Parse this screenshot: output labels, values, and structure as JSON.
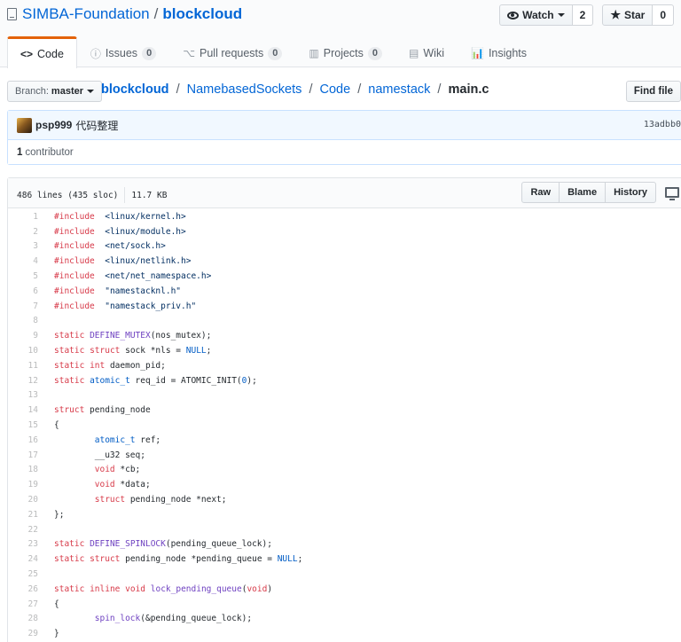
{
  "repo": {
    "owner": "SIMBA-Foundation",
    "separator": "/",
    "name": "blockcloud",
    "icon": "repo-book-icon"
  },
  "actions": {
    "watch_label": "Watch",
    "watch_count": "2",
    "star_label": "Star",
    "star_count": "0"
  },
  "tabs": [
    {
      "label": "Code",
      "icon": "code-icon",
      "selected": true
    },
    {
      "label": "Issues",
      "icon": "issue-icon",
      "count": "0"
    },
    {
      "label": "Pull requests",
      "icon": "pull-request-icon",
      "count": "0"
    },
    {
      "label": "Projects",
      "icon": "project-icon",
      "count": "0"
    },
    {
      "label": "Wiki",
      "icon": "book-icon"
    },
    {
      "label": "Insights",
      "icon": "graph-icon"
    }
  ],
  "branch": {
    "prefix": "Branch:",
    "name": "master"
  },
  "breadcrumb": {
    "root": "blockcloud",
    "parts": [
      "NamebasedSockets",
      "Code",
      "namestack"
    ],
    "file": "main.c",
    "sep": "/"
  },
  "find_file_label": "Find file",
  "commit": {
    "author": "psp999",
    "message": "代码整理",
    "sha": "13adbb0"
  },
  "contributors": {
    "count": "1",
    "label": "contributor"
  },
  "file": {
    "lines_info": "486 lines (435 sloc)",
    "size": "11.7 KB",
    "raw_label": "Raw",
    "blame_label": "Blame",
    "history_label": "History",
    "desktop_icon": "desktop-icon"
  },
  "code_lines": [
    {
      "n": "1",
      "tokens": [
        [
          "k",
          "#include"
        ],
        [
          "",
          "  "
        ],
        [
          "s",
          "<linux/kernel.h>"
        ]
      ]
    },
    {
      "n": "2",
      "tokens": [
        [
          "k",
          "#include"
        ],
        [
          "",
          "  "
        ],
        [
          "s",
          "<linux/module.h>"
        ]
      ]
    },
    {
      "n": "3",
      "tokens": [
        [
          "k",
          "#include"
        ],
        [
          "",
          "  "
        ],
        [
          "s",
          "<net/sock.h>"
        ]
      ]
    },
    {
      "n": "4",
      "tokens": [
        [
          "k",
          "#include"
        ],
        [
          "",
          "  "
        ],
        [
          "s",
          "<linux/netlink.h>"
        ]
      ]
    },
    {
      "n": "5",
      "tokens": [
        [
          "k",
          "#include"
        ],
        [
          "",
          "  "
        ],
        [
          "s",
          "<net/net_namespace.h>"
        ]
      ]
    },
    {
      "n": "6",
      "tokens": [
        [
          "k",
          "#include"
        ],
        [
          "",
          "  "
        ],
        [
          "s",
          "\"namestacknl.h\""
        ]
      ]
    },
    {
      "n": "7",
      "tokens": [
        [
          "k",
          "#include"
        ],
        [
          "",
          "  "
        ],
        [
          "s",
          "\"namestack_priv.h\""
        ]
      ]
    },
    {
      "n": "8",
      "tokens": []
    },
    {
      "n": "9",
      "tokens": [
        [
          "k",
          "static"
        ],
        [
          "",
          " "
        ],
        [
          "en",
          "DEFINE_MUTEX"
        ],
        [
          "",
          "(nos_mutex);"
        ]
      ]
    },
    {
      "n": "10",
      "tokens": [
        [
          "k",
          "static"
        ],
        [
          "",
          " "
        ],
        [
          "k",
          "struct"
        ],
        [
          "",
          " sock *nls = "
        ],
        [
          "c1",
          "NULL"
        ],
        [
          "",
          ";"
        ]
      ]
    },
    {
      "n": "11",
      "tokens": [
        [
          "k",
          "static"
        ],
        [
          "",
          " "
        ],
        [
          "k",
          "int"
        ],
        [
          "",
          " daemon_pid;"
        ]
      ]
    },
    {
      "n": "12",
      "tokens": [
        [
          "k",
          "static"
        ],
        [
          "",
          " "
        ],
        [
          "c1",
          "atomic_t"
        ],
        [
          "",
          " req_id = ATOMIC_INIT("
        ],
        [
          "c1",
          "0"
        ],
        [
          "",
          ");"
        ]
      ]
    },
    {
      "n": "13",
      "tokens": []
    },
    {
      "n": "14",
      "tokens": [
        [
          "k",
          "struct"
        ],
        [
          "",
          " pending_node"
        ]
      ]
    },
    {
      "n": "15",
      "tokens": [
        [
          "",
          "{"
        ]
      ]
    },
    {
      "n": "16",
      "tokens": [
        [
          "",
          "        "
        ],
        [
          "c1",
          "atomic_t"
        ],
        [
          "",
          " ref;"
        ]
      ]
    },
    {
      "n": "17",
      "tokens": [
        [
          "",
          "        __u32 seq;"
        ]
      ]
    },
    {
      "n": "18",
      "tokens": [
        [
          "",
          "        "
        ],
        [
          "k",
          "void"
        ],
        [
          "",
          " *cb;"
        ]
      ]
    },
    {
      "n": "19",
      "tokens": [
        [
          "",
          "        "
        ],
        [
          "k",
          "void"
        ],
        [
          "",
          " *data;"
        ]
      ]
    },
    {
      "n": "20",
      "tokens": [
        [
          "",
          "        "
        ],
        [
          "k",
          "struct"
        ],
        [
          "",
          " pending_node *next;"
        ]
      ]
    },
    {
      "n": "21",
      "tokens": [
        [
          "",
          "};"
        ]
      ]
    },
    {
      "n": "22",
      "tokens": []
    },
    {
      "n": "23",
      "tokens": [
        [
          "k",
          "static"
        ],
        [
          "",
          " "
        ],
        [
          "en",
          "DEFINE_SPINLOCK"
        ],
        [
          "",
          "(pending_queue_lock);"
        ]
      ]
    },
    {
      "n": "24",
      "tokens": [
        [
          "k",
          "static"
        ],
        [
          "",
          " "
        ],
        [
          "k",
          "struct"
        ],
        [
          "",
          " pending_node *pending_queue = "
        ],
        [
          "c1",
          "NULL"
        ],
        [
          "",
          ";"
        ]
      ]
    },
    {
      "n": "25",
      "tokens": []
    },
    {
      "n": "26",
      "tokens": [
        [
          "k",
          "static"
        ],
        [
          "",
          " "
        ],
        [
          "k",
          "inline"
        ],
        [
          "",
          " "
        ],
        [
          "k",
          "void"
        ],
        [
          "",
          " "
        ],
        [
          "en",
          "lock_pending_queue"
        ],
        [
          "",
          "("
        ],
        [
          "k",
          "void"
        ],
        [
          "",
          ")"
        ]
      ]
    },
    {
      "n": "27",
      "tokens": [
        [
          "",
          "{"
        ]
      ]
    },
    {
      "n": "28",
      "tokens": [
        [
          "",
          "        "
        ],
        [
          "en",
          "spin_lock"
        ],
        [
          "",
          "(&pending_queue_lock);"
        ]
      ]
    },
    {
      "n": "29",
      "tokens": [
        [
          "",
          "}"
        ]
      ]
    }
  ]
}
